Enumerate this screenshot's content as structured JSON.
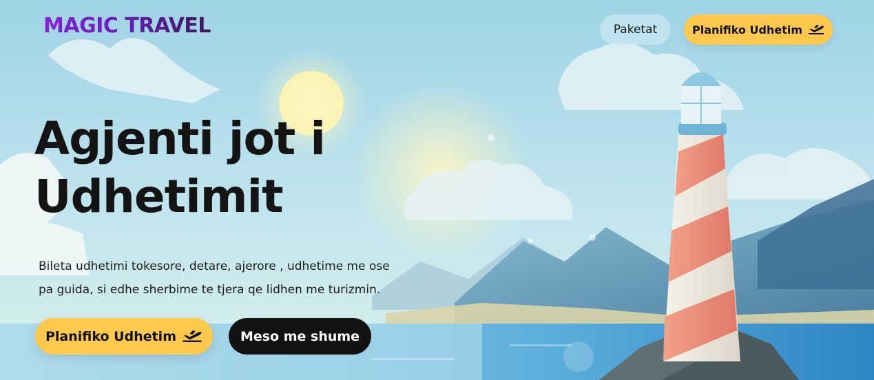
{
  "brand": {
    "name": "MAGIC TRAVEL"
  },
  "nav": {
    "packages_label": "Paketat",
    "plan_label": "Planifiko Udhetim",
    "plan_icon": "plane-departure-icon"
  },
  "hero": {
    "headline_line1": "Agjenti jot i",
    "headline_line2": "Udhetimit",
    "subtext_line1": "Bileta udhetimi tokesore, detare, ajerore , udhetime me ose",
    "subtext_line2": "pa guida, si edhe sherbime te tjera qe lidhen me turizmin.",
    "primary_cta": "Planifiko Udhetim",
    "secondary_cta": "Meso me shume"
  },
  "colors": {
    "accent_yellow": "#ffc94d",
    "dark_button": "#121212",
    "brand_purple": "#8a1fd6",
    "sky": "#a9d8e6"
  }
}
